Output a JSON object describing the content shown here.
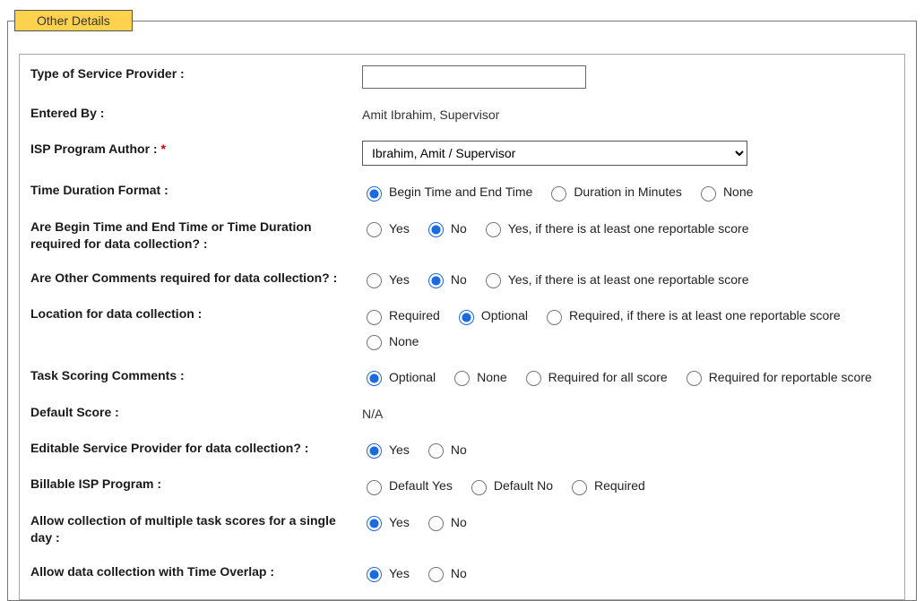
{
  "legend": "Other Details",
  "fields": {
    "type_provider": {
      "label": "Type of Service Provider :",
      "value": ""
    },
    "entered_by": {
      "label": "Entered By :",
      "value": "Amit Ibrahim, Supervisor"
    },
    "author": {
      "label": "ISP Program Author :",
      "required_marker": "*",
      "selected": "Ibrahim, Amit / Supervisor"
    },
    "time_format": {
      "label": "Time Duration Format :",
      "options": [
        "Begin Time and End Time",
        "Duration in Minutes",
        "None"
      ]
    },
    "time_required": {
      "label": "Are Begin Time and End Time or Time Duration required for data collection? :",
      "options": [
        "Yes",
        "No",
        "Yes, if there is at least one reportable score"
      ]
    },
    "comments_required": {
      "label": "Are Other Comments required for data collection? :",
      "options": [
        "Yes",
        "No",
        "Yes, if there is at least one reportable score"
      ]
    },
    "location": {
      "label": "Location for data collection :",
      "options": [
        "Required",
        "Optional",
        "Required, if there is at least one reportable score",
        "None"
      ]
    },
    "task_scoring": {
      "label": "Task Scoring Comments :",
      "options": [
        "Optional",
        "None",
        "Required for all score",
        "Required for reportable score"
      ]
    },
    "default_score": {
      "label": "Default Score :",
      "value": "N/A"
    },
    "editable_provider": {
      "label": "Editable Service Provider for data collection? :",
      "options": [
        "Yes",
        "No"
      ]
    },
    "billable": {
      "label": "Billable ISP Program :",
      "options": [
        "Default Yes",
        "Default No",
        "Required"
      ]
    },
    "multiple_scores": {
      "label": "Allow collection of multiple task scores for a single day :",
      "options": [
        "Yes",
        "No"
      ]
    },
    "time_overlap": {
      "label": "Allow data collection with Time Overlap :",
      "options": [
        "Yes",
        "No"
      ]
    }
  }
}
